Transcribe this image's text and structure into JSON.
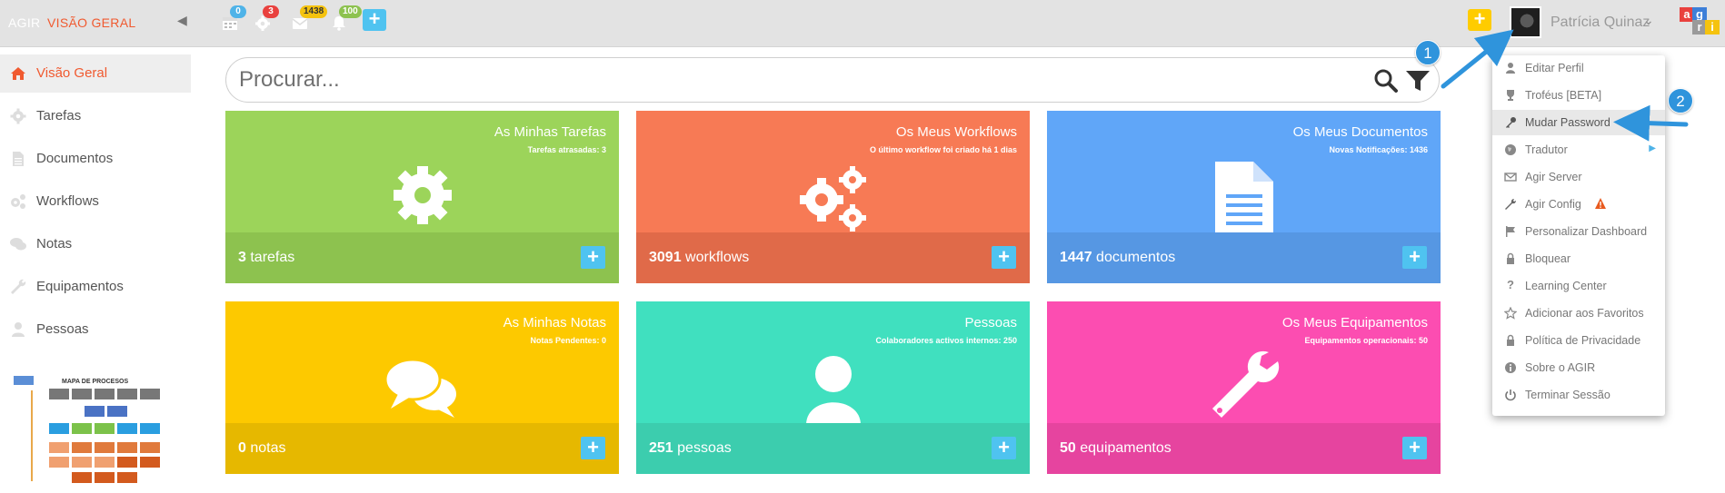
{
  "topbar": {
    "brand": "AGIR",
    "section": "VISÃO GERAL",
    "badges": {
      "calendar": "0",
      "tasks": "3",
      "messages": "1438",
      "notifications": "100"
    },
    "user_name": "Patrícia Quinaz",
    "colors": {
      "yellow": "#ffcc00",
      "blue": "#4fc3f0",
      "red": "#e9413e"
    }
  },
  "sidebar": {
    "items": [
      {
        "label": "Visão Geral",
        "icon": "home-icon"
      },
      {
        "label": "Tarefas",
        "icon": "gear-icon"
      },
      {
        "label": "Documentos",
        "icon": "document-icon"
      },
      {
        "label": "Workflows",
        "icon": "gears-icon"
      },
      {
        "label": "Notas",
        "icon": "comments-icon"
      },
      {
        "label": "Equipamentos",
        "icon": "wrench-icon"
      },
      {
        "label": "Pessoas",
        "icon": "user-icon"
      }
    ],
    "thumbnail_title": "MAPA DE PROCESOS"
  },
  "search": {
    "placeholder": "Procurar..."
  },
  "tiles": [
    {
      "title": "As Minhas Tarefas",
      "subtitle": "Tarefas atrasadas: 3",
      "count": "3",
      "unit": "tarefas",
      "color": "#9cd45a",
      "foot": "#8dc24f"
    },
    {
      "title": "Os Meus Workflows",
      "subtitle": "O último workflow foi criado há 1 dias",
      "count": "3091",
      "unit": "workflows",
      "color": "#f77a55",
      "foot": "#e06a49"
    },
    {
      "title": "Os Meus Documentos",
      "subtitle": "Novas Notificações: 1436",
      "count": "1447",
      "unit": "documentos",
      "color": "#60a6f8",
      "foot": "#5697e3"
    },
    {
      "title": "As Minhas Notas",
      "subtitle": "Notas Pendentes: 0",
      "count": "0",
      "unit": "notas",
      "color": "#fdc900",
      "foot": "#e6b800"
    },
    {
      "title": "Pessoas",
      "subtitle": "Colaboradores activos internos: 250",
      "count": "251",
      "unit": "pessoas",
      "color": "#40e0bf",
      "foot": "#3ccdae"
    },
    {
      "title": "Os Meus Equipamentos",
      "subtitle": "Equipamentos operacionais: 50",
      "count": "50",
      "unit": "equipamentos",
      "color": "#fc4db1",
      "foot": "#e6449f"
    }
  ],
  "dropdown": {
    "items": [
      {
        "label": "Editar Perfil",
        "icon": "user-icon"
      },
      {
        "label": "Troféus [BETA]",
        "icon": "trophy-icon"
      },
      {
        "label": "Mudar Password",
        "icon": "key-icon"
      },
      {
        "label": "Tradutor",
        "icon": "globe-icon"
      },
      {
        "label": "Agir Server",
        "icon": "envelope-icon"
      },
      {
        "label": "Agir Config",
        "icon": "wrench-icon"
      },
      {
        "label": "Personalizar Dashboard",
        "icon": "flag-icon"
      },
      {
        "label": "Bloquear",
        "icon": "lock-icon"
      },
      {
        "label": "Learning Center",
        "icon": "question-icon"
      },
      {
        "label": "Adicionar aos Favoritos",
        "icon": "star-icon"
      },
      {
        "label": "Política de Privacidade",
        "icon": "lock-icon"
      },
      {
        "label": "Sobre o AGIR",
        "icon": "info-icon"
      },
      {
        "label": "Terminar Sessão",
        "icon": "power-icon"
      }
    ]
  },
  "callouts": {
    "first": "1",
    "second": "2"
  }
}
